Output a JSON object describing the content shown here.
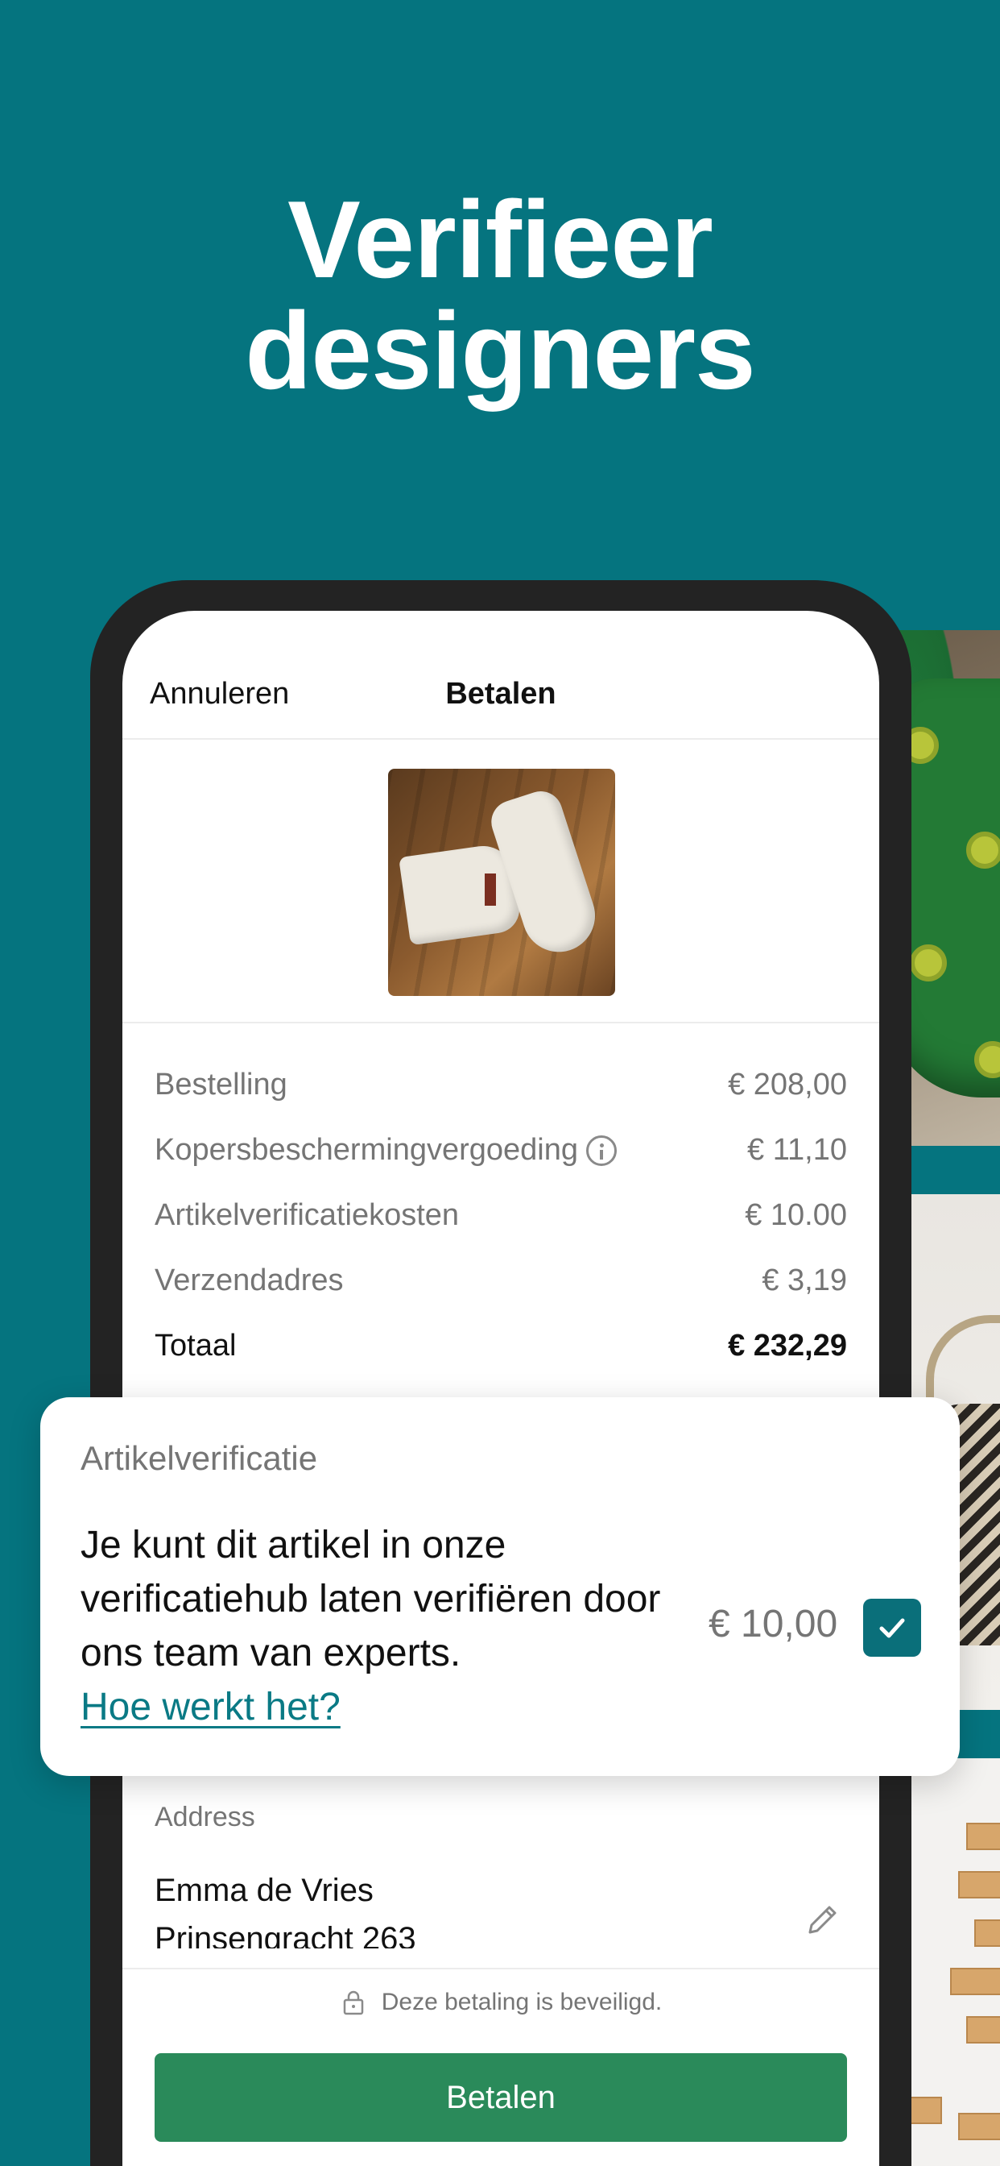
{
  "headline": {
    "line1": "Verifieer",
    "line2": "designers"
  },
  "nav": {
    "cancel": "Annuleren",
    "title": "Betalen"
  },
  "prices": [
    {
      "label": "Bestelling",
      "value": "€ 208,00"
    },
    {
      "label": "Kopersbeschermingvergoeding",
      "value": "€ 11,10"
    },
    {
      "label": "Artikelverificatiekosten",
      "value": "€ 10.00"
    },
    {
      "label": "Verzendadres",
      "value": "€ 3,19"
    },
    {
      "label": "Totaal",
      "value": "€ 232,29"
    }
  ],
  "card": {
    "title": "Artikelverificatie",
    "text": "Je kunt dit artikel in onze verificatiehub laten verifiëren door ons team van experts.",
    "link": "Hoe werkt het?",
    "price": "€ 10,00",
    "checked": true
  },
  "address": {
    "label": "Address",
    "name": "Emma de Vries",
    "street": "Prinsengracht 263"
  },
  "secure_text": "Deze betaling is beveiligd.",
  "pay_button": "Betalen",
  "colors": {
    "background": "#05747f",
    "button": "#2a8a5a",
    "checkbox": "#0a6f7a",
    "link": "#0a7a85"
  },
  "icons": [
    "info-icon",
    "pencil-icon",
    "lock-icon",
    "check-icon"
  ]
}
